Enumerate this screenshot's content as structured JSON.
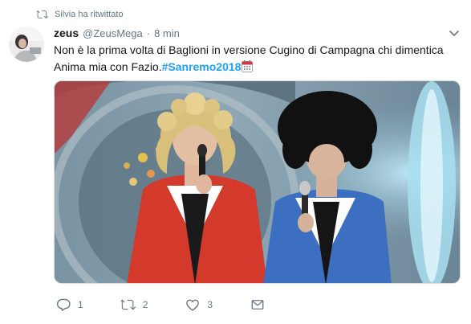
{
  "retweet": {
    "icon": "retweet-icon",
    "text": "Silvia ha ritwittato"
  },
  "author": {
    "name": "zeus",
    "handle": "@ZeusMega",
    "separator": "·",
    "time": "8 min",
    "avatar_icon": "user-avatar"
  },
  "tweet": {
    "line1": "Non è la prima volta di Baglioni in versione Cugino di Campagna chi dimentica",
    "line2_text": "Anima mia con Fazio.",
    "hashtag": "#Sanremo2018",
    "emoji": "calendar-emoji"
  },
  "media": {
    "description_icon": "video-thumbnail"
  },
  "actions": {
    "reply": {
      "icon": "reply-icon",
      "count": "1"
    },
    "retweet": {
      "icon": "retweet-icon",
      "count": "2"
    },
    "like": {
      "icon": "heart-icon",
      "count": "3"
    },
    "dm": {
      "icon": "envelope-icon"
    }
  },
  "colors": {
    "link": "#1da1f2",
    "muted": "#657786",
    "text": "#14171a"
  }
}
